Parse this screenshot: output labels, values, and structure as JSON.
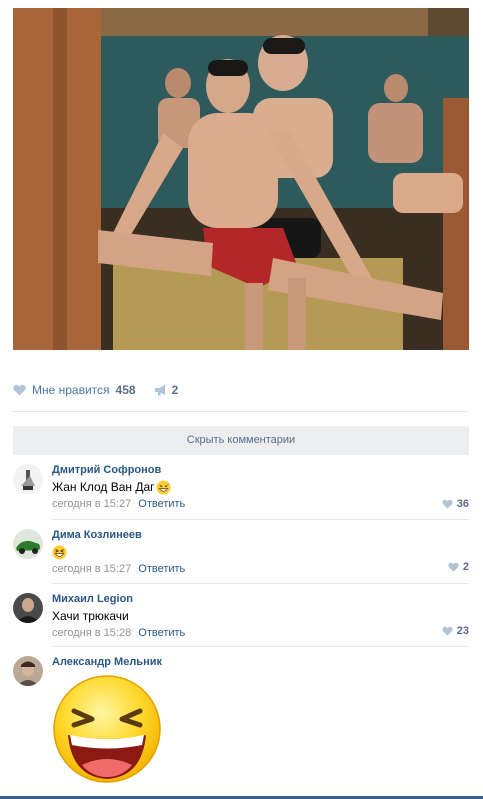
{
  "post": {
    "likes_label": "Мне нравится",
    "likes_count": "458",
    "shares_count": "2",
    "hide_comments_label": "Скрыть комментарии"
  },
  "comments": [
    {
      "author": "Дмитрий Софронов",
      "text": "Жан Клод Ван Даг",
      "emoji": "grin-sweat",
      "time": "сегодня в 15:27",
      "reply": "Ответить",
      "likes": "36"
    },
    {
      "author": "Дима Козлинеев",
      "text": "",
      "emoji": "laughing",
      "time": "сегодня в 15:27",
      "reply": "Ответить",
      "likes": "2"
    },
    {
      "author": "Михаил Legion",
      "text": "Хачи трюкачи",
      "time": "сегодня в 15:28",
      "reply": "Ответить",
      "likes": "23"
    },
    {
      "author": "Александр Мельник",
      "sticker": "big-laughing-smiley"
    }
  ],
  "colors": {
    "link": "#2a5885",
    "muted": "#939393",
    "accent": "#4a76a8",
    "button_bg": "#edeef0",
    "divider": "#e7e8ec"
  }
}
